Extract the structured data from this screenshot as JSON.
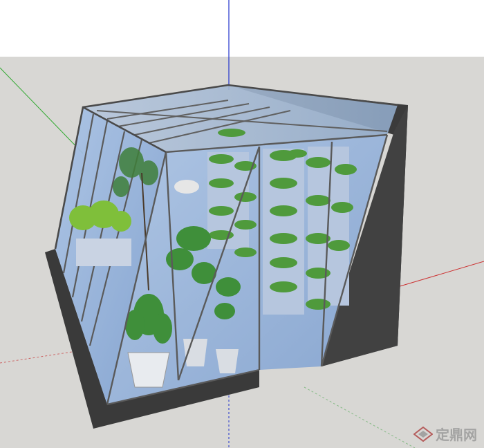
{
  "scene": {
    "sky_color": "#ffffff",
    "ground_color": "#d8d7d4",
    "glass_color": "#8fb1d8",
    "frame_color": "#5a5a5a",
    "concrete_color": "#3a3a3a",
    "plant_color": "#4f9a3c",
    "axis_colors": {
      "x": "#cc3333",
      "y": "#33aa33",
      "z": "#2233cc"
    }
  },
  "watermark": {
    "text": "定鼎网",
    "logo_icon": "diamond-logo-icon"
  }
}
